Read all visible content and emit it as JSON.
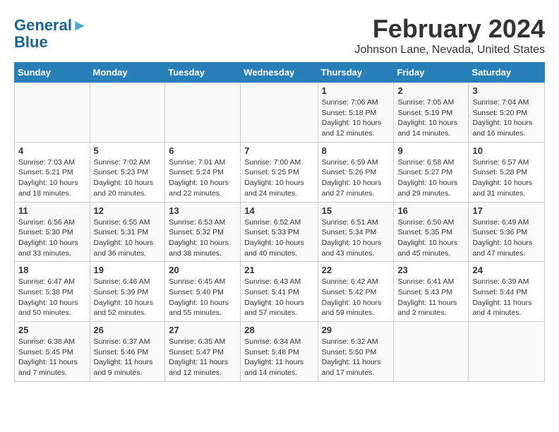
{
  "logo": {
    "line1": "General",
    "line2": "Blue"
  },
  "header": {
    "title": "February 2024",
    "subtitle": "Johnson Lane, Nevada, United States"
  },
  "days_of_week": [
    "Sunday",
    "Monday",
    "Tuesday",
    "Wednesday",
    "Thursday",
    "Friday",
    "Saturday"
  ],
  "weeks": [
    [
      {
        "num": "",
        "info": ""
      },
      {
        "num": "",
        "info": ""
      },
      {
        "num": "",
        "info": ""
      },
      {
        "num": "",
        "info": ""
      },
      {
        "num": "1",
        "info": "Sunrise: 7:06 AM\nSunset: 5:18 PM\nDaylight: 10 hours\nand 12 minutes."
      },
      {
        "num": "2",
        "info": "Sunrise: 7:05 AM\nSunset: 5:19 PM\nDaylight: 10 hours\nand 14 minutes."
      },
      {
        "num": "3",
        "info": "Sunrise: 7:04 AM\nSunset: 5:20 PM\nDaylight: 10 hours\nand 16 minutes."
      }
    ],
    [
      {
        "num": "4",
        "info": "Sunrise: 7:03 AM\nSunset: 5:21 PM\nDaylight: 10 hours\nand 18 minutes."
      },
      {
        "num": "5",
        "info": "Sunrise: 7:02 AM\nSunset: 5:23 PM\nDaylight: 10 hours\nand 20 minutes."
      },
      {
        "num": "6",
        "info": "Sunrise: 7:01 AM\nSunset: 5:24 PM\nDaylight: 10 hours\nand 22 minutes."
      },
      {
        "num": "7",
        "info": "Sunrise: 7:00 AM\nSunset: 5:25 PM\nDaylight: 10 hours\nand 24 minutes."
      },
      {
        "num": "8",
        "info": "Sunrise: 6:59 AM\nSunset: 5:26 PM\nDaylight: 10 hours\nand 27 minutes."
      },
      {
        "num": "9",
        "info": "Sunrise: 6:58 AM\nSunset: 5:27 PM\nDaylight: 10 hours\nand 29 minutes."
      },
      {
        "num": "10",
        "info": "Sunrise: 6:57 AM\nSunset: 5:28 PM\nDaylight: 10 hours\nand 31 minutes."
      }
    ],
    [
      {
        "num": "11",
        "info": "Sunrise: 6:56 AM\nSunset: 5:30 PM\nDaylight: 10 hours\nand 33 minutes."
      },
      {
        "num": "12",
        "info": "Sunrise: 6:55 AM\nSunset: 5:31 PM\nDaylight: 10 hours\nand 36 minutes."
      },
      {
        "num": "13",
        "info": "Sunrise: 6:53 AM\nSunset: 5:32 PM\nDaylight: 10 hours\nand 38 minutes."
      },
      {
        "num": "14",
        "info": "Sunrise: 6:52 AM\nSunset: 5:33 PM\nDaylight: 10 hours\nand 40 minutes."
      },
      {
        "num": "15",
        "info": "Sunrise: 6:51 AM\nSunset: 5:34 PM\nDaylight: 10 hours\nand 43 minutes."
      },
      {
        "num": "16",
        "info": "Sunrise: 6:50 AM\nSunset: 5:35 PM\nDaylight: 10 hours\nand 45 minutes."
      },
      {
        "num": "17",
        "info": "Sunrise: 6:49 AM\nSunset: 5:36 PM\nDaylight: 10 hours\nand 47 minutes."
      }
    ],
    [
      {
        "num": "18",
        "info": "Sunrise: 6:47 AM\nSunset: 5:38 PM\nDaylight: 10 hours\nand 50 minutes."
      },
      {
        "num": "19",
        "info": "Sunrise: 6:46 AM\nSunset: 5:39 PM\nDaylight: 10 hours\nand 52 minutes."
      },
      {
        "num": "20",
        "info": "Sunrise: 6:45 AM\nSunset: 5:40 PM\nDaylight: 10 hours\nand 55 minutes."
      },
      {
        "num": "21",
        "info": "Sunrise: 6:43 AM\nSunset: 5:41 PM\nDaylight: 10 hours\nand 57 minutes."
      },
      {
        "num": "22",
        "info": "Sunrise: 6:42 AM\nSunset: 5:42 PM\nDaylight: 10 hours\nand 59 minutes."
      },
      {
        "num": "23",
        "info": "Sunrise: 6:41 AM\nSunset: 5:43 PM\nDaylight: 11 hours\nand 2 minutes."
      },
      {
        "num": "24",
        "info": "Sunrise: 6:39 AM\nSunset: 5:44 PM\nDaylight: 11 hours\nand 4 minutes."
      }
    ],
    [
      {
        "num": "25",
        "info": "Sunrise: 6:38 AM\nSunset: 5:45 PM\nDaylight: 11 hours\nand 7 minutes."
      },
      {
        "num": "26",
        "info": "Sunrise: 6:37 AM\nSunset: 5:46 PM\nDaylight: 11 hours\nand 9 minutes."
      },
      {
        "num": "27",
        "info": "Sunrise: 6:35 AM\nSunset: 5:47 PM\nDaylight: 11 hours\nand 12 minutes."
      },
      {
        "num": "28",
        "info": "Sunrise: 6:34 AM\nSunset: 5:48 PM\nDaylight: 11 hours\nand 14 minutes."
      },
      {
        "num": "29",
        "info": "Sunrise: 6:32 AM\nSunset: 5:50 PM\nDaylight: 11 hours\nand 17 minutes."
      },
      {
        "num": "",
        "info": ""
      },
      {
        "num": "",
        "info": ""
      }
    ]
  ]
}
